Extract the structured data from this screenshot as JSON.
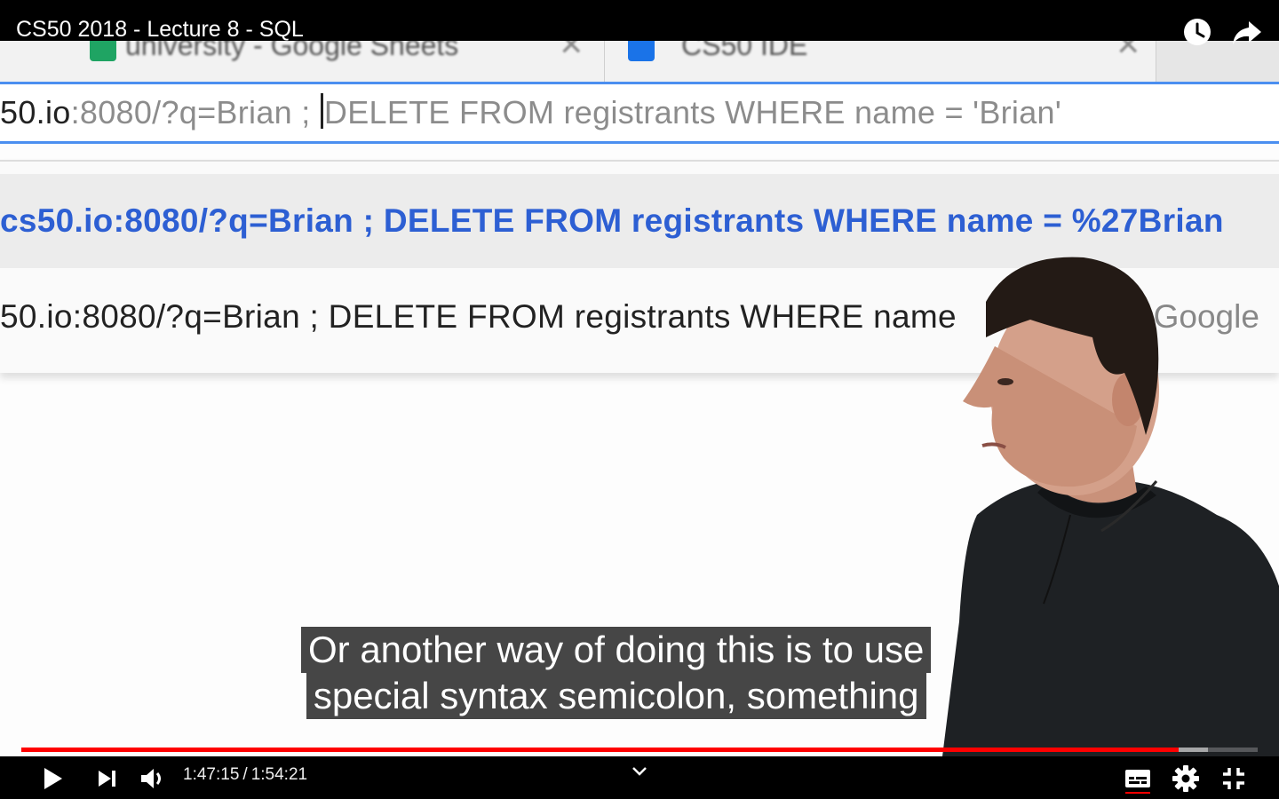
{
  "video": {
    "title": "CS50 2018 - Lecture 8 - SQL",
    "current_time": "1:47:15",
    "separator": "/",
    "duration": "1:54:21",
    "played_fraction": 0.936,
    "buffered_fraction": 0.96
  },
  "browser": {
    "tabs": [
      {
        "label": "university - Google Sheets",
        "icon": "sheets-icon",
        "color": "#1fa463"
      },
      {
        "label": "CS50 IDE",
        "icon": "ide-icon",
        "color": "#1a73e8"
      }
    ],
    "omnibox": {
      "host": "50.io",
      "rest": ":8080/?q=Brian ; ",
      "typed": "DELETE FROM registrants WHERE name = 'Brian'"
    },
    "suggestions": [
      {
        "text": "cs50.io:8080/?q=Brian ; DELETE FROM registrants WHERE name = %27Brian"
      },
      {
        "text": "50.io:8080/?q=Brian ; DELETE FROM registrants WHERE name",
        "suffix": "- Google"
      }
    ]
  },
  "captions": {
    "line1": "Or another way of doing this is to use",
    "line2": "special syntax semicolon, something"
  },
  "colors": {
    "progress_played": "#ff0000",
    "link_blue": "#2d5fd3",
    "omnibox_focus": "#4b8ff0"
  },
  "icons": {
    "watch_later": "clock-icon",
    "share": "share-icon",
    "play": "play-icon",
    "next": "next-icon",
    "volume": "volume-icon",
    "subtitles": "subtitles-icon",
    "settings": "gear-icon",
    "exit_fullscreen": "exit-fullscreen-icon"
  }
}
